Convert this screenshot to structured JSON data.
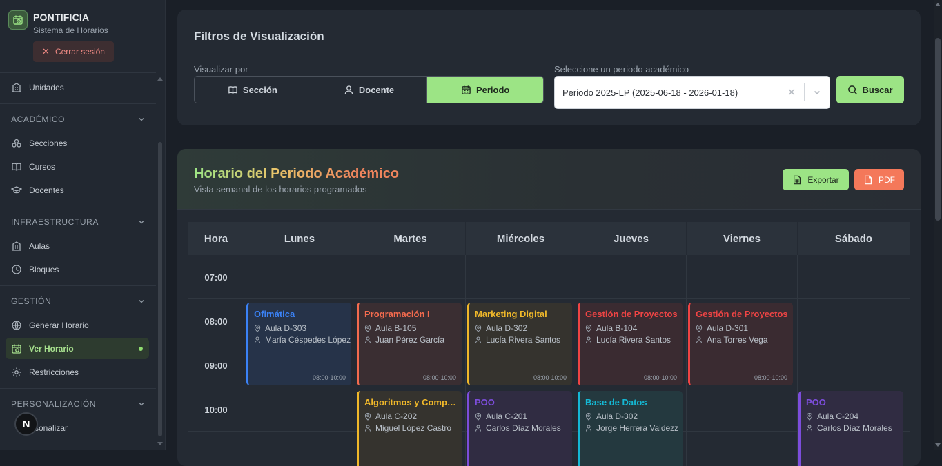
{
  "brand": {
    "name": "PONTIFICIA",
    "subtitle": "Sistema de Horarios"
  },
  "logout_label": "Cerrar sesión",
  "sidebar": {
    "top_item": "Unidades",
    "sections": [
      {
        "title": "ACADÉMICO",
        "items": [
          "Secciones",
          "Cursos",
          "Docentes"
        ]
      },
      {
        "title": "INFRAESTRUCTURA",
        "items": [
          "Aulas",
          "Bloques"
        ]
      },
      {
        "title": "GESTIÓN",
        "items": [
          "Generar Horario",
          "Ver Horario",
          "Restricciones"
        ]
      },
      {
        "title": "PERSONALIZACIÓN",
        "items": [
          "Personalizar"
        ]
      }
    ],
    "active_item": "Ver Horario",
    "avatar_letter": "N",
    "visible_personalizar": "rsonalizar"
  },
  "filters": {
    "title": "Filtros de Visualización",
    "view_label": "Visualizar por",
    "view_options": [
      "Sección",
      "Docente",
      "Periodo"
    ],
    "selected_view": "Periodo",
    "period_label": "Seleccione un periodo académico",
    "period_value": "Periodo 2025-LP (2025-06-18 - 2026-01-18)",
    "search_label": "Buscar"
  },
  "schedule": {
    "title": "Horario del Periodo Académico",
    "subtitle": "Vista semanal de los horarios programados",
    "export_label": "Exportar",
    "pdf_label": "PDF",
    "hour_header": "Hora",
    "days": [
      "Lunes",
      "Martes",
      "Miércoles",
      "Jueves",
      "Viernes",
      "Sábado"
    ],
    "hours": [
      "07:00",
      "08:00",
      "09:00",
      "10:00"
    ],
    "events": [
      {
        "title": "Ofimática",
        "room": "Aula D-303",
        "teacher": "María Céspedes López",
        "time": "08:00-10:00",
        "color": "#3b82f6",
        "bg": "#263349"
      },
      {
        "title": "Programación I",
        "room": "Aula B-105",
        "teacher": "Juan Pérez García",
        "time": "08:00-10:00",
        "color": "#f46b4e",
        "bg": "#3a2e32"
      },
      {
        "title": "Marketing Digital",
        "room": "Aula D-302",
        "teacher": "Lucía Rivera Santos",
        "time": "08:00-10:00",
        "color": "#f0b82a",
        "bg": "#35332e"
      },
      {
        "title": "Gestión de Proyectos",
        "room": "Aula B-104",
        "teacher": "Lucía Rivera Santos",
        "time": "08:00-10:00",
        "color": "#ef4444",
        "bg": "#3a2b31"
      },
      {
        "title": "Gestión de Proyectos",
        "room": "Aula D-301",
        "teacher": "Ana Torres Vega",
        "time": "08:00-10:00",
        "color": "#ef4444",
        "bg": "#3a2b31"
      },
      {
        "title": "Algoritmos y Computación",
        "room": "Aula C-202",
        "teacher": "Miguel López Castro",
        "color": "#f0b82a",
        "bg": "#35332e"
      },
      {
        "title": "POO",
        "room": "Aula C-201",
        "teacher": "Carlos Díaz Morales",
        "color": "#7c4ddb",
        "bg": "#302c42"
      },
      {
        "title": "Base de Datos",
        "room": "Aula D-302",
        "teacher": "Jorge Herrera Valdezz",
        "color": "#14b8d4",
        "bg": "#24393f"
      },
      {
        "title": "POO",
        "room": "Aula C-204",
        "teacher": "Carlos Díaz Morales",
        "color": "#7c4ddb",
        "bg": "#302c42"
      }
    ]
  }
}
